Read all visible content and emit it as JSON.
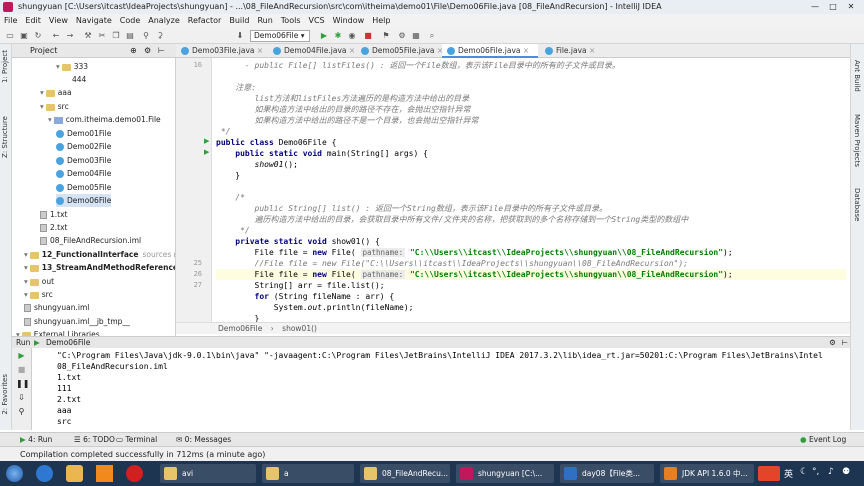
{
  "title": "shungyuan [C:\\Users\\itcast\\IdeaProjects\\shungyuan] - ...\\08_FileAndRecursion\\src\\com\\itheima\\demo01\\File\\Demo06File.java [08_FileAndRecursion] - IntelliJ IDEA",
  "window_controls": [
    "—",
    "□",
    "✕"
  ],
  "menu": [
    "File",
    "Edit",
    "View",
    "Navigate",
    "Code",
    "Analyze",
    "Refactor",
    "Build",
    "Run",
    "Tools",
    "VCS",
    "Window",
    "Help"
  ],
  "run_config": "Demo06File ▾",
  "project_panel_title": "Project",
  "left_tabs": [
    "1: Project",
    "Z: Structure",
    "2: Favorites"
  ],
  "right_tabs": [
    "Ant Build",
    "Maven Projects",
    "Database"
  ],
  "tree": [
    {
      "label": "333",
      "kind": "folder",
      "indent": 5
    },
    {
      "label": "444",
      "kind": "text",
      "indent": 7
    },
    {
      "label": "aaa",
      "kind": "folder",
      "indent": 3
    },
    {
      "label": "src",
      "kind": "folder",
      "indent": 3
    },
    {
      "label": "com.itheima.demo01.File",
      "kind": "pkg",
      "indent": 4
    },
    {
      "label": "Demo01File",
      "kind": "class",
      "indent": 5
    },
    {
      "label": "Demo02File",
      "kind": "class",
      "indent": 5
    },
    {
      "label": "Demo03File",
      "kind": "class",
      "indent": 5
    },
    {
      "label": "Demo04File",
      "kind": "class",
      "indent": 5
    },
    {
      "label": "Demo05File",
      "kind": "class",
      "indent": 5
    },
    {
      "label": "Demo06File",
      "kind": "class",
      "indent": 5
    },
    {
      "label": "1.txt",
      "kind": "txt",
      "indent": 3
    },
    {
      "label": "2.txt",
      "kind": "txt",
      "indent": 3
    },
    {
      "label": "08_FileAndRecursion.iml",
      "kind": "txt",
      "indent": 3
    },
    {
      "label": "12_FunctionalInterface",
      "extra": "sources r...",
      "kind": "folder",
      "indent": 1,
      "bold": true
    },
    {
      "label": "13_StreamAndMethodReference",
      "kind": "folder",
      "indent": 1,
      "bold": true
    },
    {
      "label": "out",
      "kind": "folder",
      "indent": 1
    },
    {
      "label": "src",
      "kind": "folder",
      "indent": 1
    },
    {
      "label": "shungyuan.iml",
      "kind": "txt",
      "indent": 1
    },
    {
      "label": "shungyuan.iml__jb_tmp__",
      "kind": "txt",
      "indent": 1
    },
    {
      "label": "External Libraries",
      "kind": "folder",
      "indent": 0
    }
  ],
  "tabs": [
    "Demo03File.java",
    "Demo04File.java",
    "Demo05File.java",
    "Demo06File.java",
    "File.java"
  ],
  "active_tab": 3,
  "line_numbers": [
    "16",
    "",
    "",
    "",
    "",
    "",
    "",
    "",
    "",
    "",
    "",
    "",
    "",
    "",
    "",
    "",
    "",
    "",
    "",
    "25",
    "26",
    "27",
    "",
    "",
    "",
    ""
  ],
  "breadcrumb": [
    "Demo06File",
    "show01()"
  ],
  "run_title": "Demo06File",
  "console": [
    "\"C:\\Program Files\\Java\\jdk-9.0.1\\bin\\java\" \"-javaagent:C:\\Program Files\\JetBrains\\IntelliJ IDEA 2017.3.2\\lib\\idea_rt.jar=50201:C:\\Program Files\\JetBrains\\Intel",
    "08_FileAndRecursion.iml",
    "1.txt",
    "111",
    "2.txt",
    "aaa",
    "src"
  ],
  "bottom_tabs": [
    "4: Run",
    "6: TODO",
    "Terminal",
    "0: Messages"
  ],
  "event_log": "Event Log",
  "status": "Compilation completed successfully in 712ms (a minute ago)",
  "taskbar": [
    {
      "label": "avi",
      "color": "#e7c46a"
    },
    {
      "label": "a",
      "color": "#e7c46a"
    },
    {
      "label": "08_FileAndRecu...",
      "color": "#e7c46a"
    },
    {
      "label": "shungyuan [C:\\...",
      "color": "#c2185b"
    },
    {
      "label": "day08【File类...",
      "color": "#2f6fc4"
    },
    {
      "label": "JDK API 1.6.0 中...",
      "color": "#e67e22"
    }
  ],
  "tray_lang": "英"
}
